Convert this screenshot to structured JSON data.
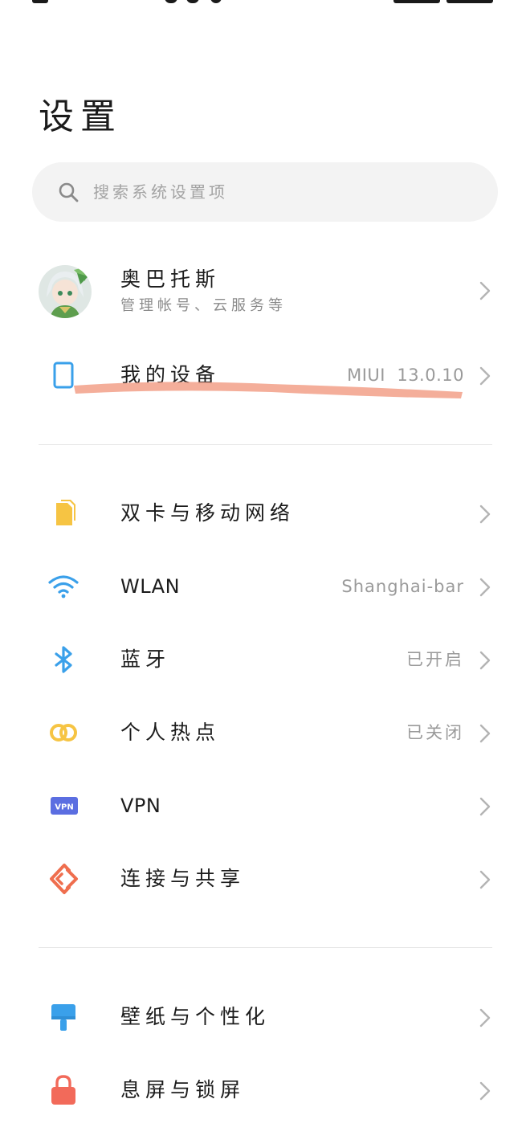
{
  "page_title": "设置",
  "search": {
    "placeholder": "搜索系统设置项",
    "icon": "search-icon"
  },
  "account": {
    "name": "奥巴托斯",
    "subtitle": "管理帐号、云服务等"
  },
  "device": {
    "label": "我的设备",
    "value": "MIUI  13.0.10",
    "icon": "tablet-icon"
  },
  "network": [
    {
      "label": "双卡与移动网络",
      "value": "",
      "icon": "sim-card-icon",
      "color": "#f6c443"
    },
    {
      "label": "WLAN",
      "value": "Shanghai-bar",
      "icon": "wifi-icon",
      "color": "#3aa0ea"
    },
    {
      "label": "蓝牙",
      "value": "已开启",
      "icon": "bluetooth-icon",
      "color": "#3aa0ea"
    },
    {
      "label": "个人热点",
      "value": "已关闭",
      "icon": "hotspot-icon",
      "color": "#f6c443"
    },
    {
      "label": "VPN",
      "value": "",
      "icon": "vpn-icon",
      "color": "#5b6ee1"
    },
    {
      "label": "连接与共享",
      "value": "",
      "icon": "share-icon",
      "color": "#ef6e4e"
    }
  ],
  "personal": [
    {
      "label": "壁纸与个性化",
      "value": "",
      "icon": "wallpaper-icon",
      "color": "#3aa0ea"
    },
    {
      "label": "息屏与锁屏",
      "value": "",
      "icon": "lock-icon",
      "color": "#f26a5a"
    }
  ],
  "colors": {
    "redaction": "#f3a58f",
    "chevron": "#b4b4b4"
  }
}
